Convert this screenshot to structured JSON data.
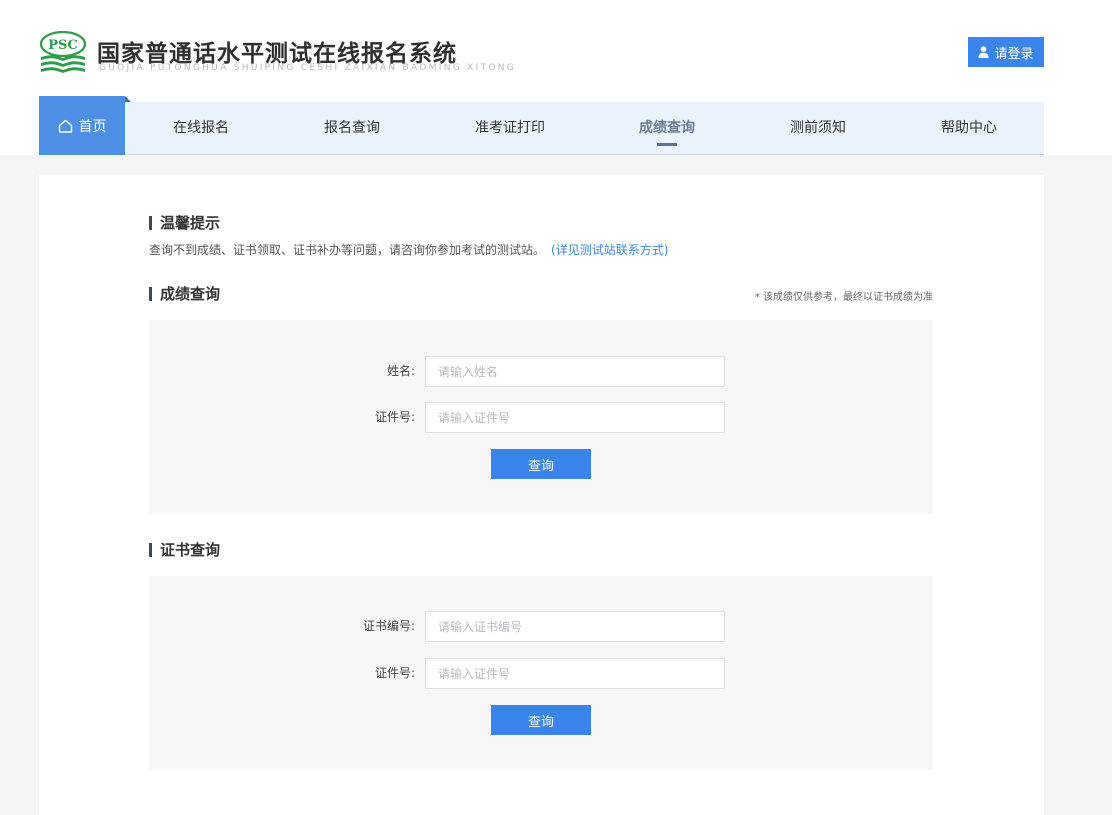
{
  "header": {
    "logo_mark_text": "PSC",
    "title": "国家普通话水平测试在线报名系统",
    "subtitle": "GUOJIA PUTONGHUA SHUIPING CESHI ZAIXIAN BAOMING XITONG",
    "login_label": "请登录"
  },
  "nav": {
    "home": "首页",
    "items": [
      "在线报名",
      "报名查询",
      "准考证打印",
      "成绩查询",
      "测前须知",
      "帮助中心"
    ],
    "active": "成绩查询"
  },
  "tips": {
    "title": "温馨提示",
    "text": "查询不到成绩、证书领取、证书补办等问题，请咨询你参加考试的测试站。",
    "link": "(详见测试站联系方式)"
  },
  "score_query": {
    "title": "成绩查询",
    "note": "* 该成绩仅供参考，最终以证书成绩为准",
    "name_label": "姓名:",
    "name_placeholder": "请输入姓名",
    "id_label": "证件号:",
    "id_placeholder": "请输入证件号",
    "button": "查询"
  },
  "cert_query": {
    "title": "证书查询",
    "cert_label": "证书编号:",
    "cert_placeholder": "请输入证书编号",
    "id_label": "证件号:",
    "id_placeholder": "请输入证件号",
    "button": "查询"
  },
  "colors": {
    "primary": "#3a85ea",
    "nav_bg": "#eaf2fc",
    "home_tab": "#4d8fe5",
    "logo_green": "#2e9e4a"
  },
  "icons": {
    "login": "user-icon",
    "home": "home-icon",
    "logo": "psc-books-logo"
  }
}
